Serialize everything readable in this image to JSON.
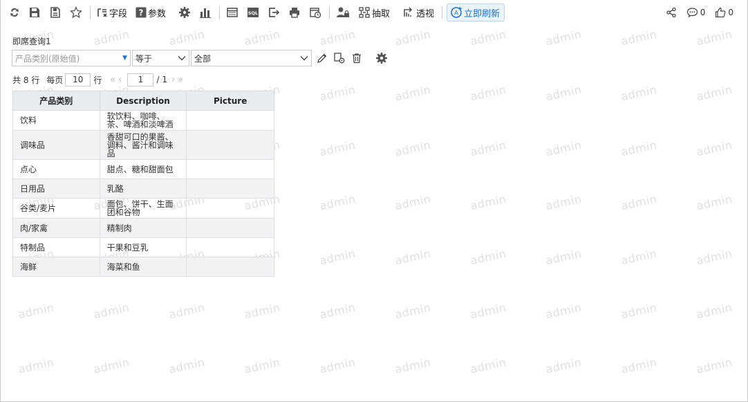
{
  "toolbar": {
    "field_label": "字段",
    "param_label": "参数",
    "extract_label": "抽取",
    "pivot_label": "透视",
    "refresh_label": "立即刷新",
    "comment_count": "0",
    "like_count": "0"
  },
  "query_title": "即席查询1",
  "filter": {
    "field": "产品类别(原始值)",
    "operator": "等于",
    "value": "全部"
  },
  "pager": {
    "total_text": "共 8 行",
    "per_page_label": "每页",
    "per_page_value": "10",
    "per_page_unit": "行",
    "current_page": "1",
    "total_pages": "/ 1"
  },
  "table": {
    "headers": [
      "产品类别",
      "Description",
      "Picture"
    ],
    "rows": [
      {
        "category": "饮料",
        "description": "软饮料、咖啡、\n茶、啤酒和淡啤酒",
        "picture": ""
      },
      {
        "category": "调味品",
        "description": "香甜可口的果酱、\n调料、酱汁和调味\n品",
        "picture": ""
      },
      {
        "category": "点心",
        "description": "甜点、糖和甜面包",
        "picture": ""
      },
      {
        "category": "日用品",
        "description": "乳酪",
        "picture": ""
      },
      {
        "category": "谷类/麦片",
        "description": "面包、饼干、生面\n团和谷物",
        "picture": ""
      },
      {
        "category": "肉/家禽",
        "description": "精制肉",
        "picture": ""
      },
      {
        "category": "特制品",
        "description": "干果和豆乳",
        "picture": ""
      },
      {
        "category": "海鲜",
        "description": "海菜和鱼",
        "picture": ""
      }
    ]
  },
  "watermark_text": "admin",
  "colors": {
    "accent": "#1f72c4",
    "header_bg": "#e9edf0",
    "alt_row_bg": "#f2f2f2",
    "watermark": "#e0e0e0"
  }
}
